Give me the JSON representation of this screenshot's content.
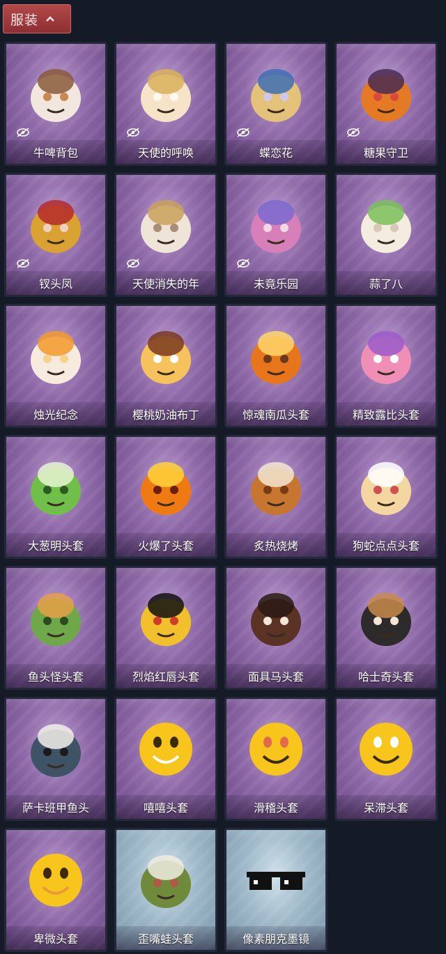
{
  "header": {
    "title": "服装",
    "icon": "chevron-up-icon"
  },
  "items": [
    {
      "name": "牛啤背包",
      "hidden": true,
      "theme": "purple",
      "art": "cow-backpack-icon",
      "colors": [
        "#f2e7df",
        "#8a5a3a",
        "#c9894e"
      ]
    },
    {
      "name": "天使的呼唤",
      "hidden": true,
      "theme": "purple",
      "art": "angel-charm-icon",
      "colors": [
        "#f6e3c8",
        "#d9b25a",
        "#fffaf0"
      ]
    },
    {
      "name": "蝶恋花",
      "hidden": true,
      "theme": "purple",
      "art": "butterfly-bell-icon",
      "colors": [
        "#e5c27a",
        "#3e6fb3",
        "#d0c8e8"
      ]
    },
    {
      "name": "糖果守卫",
      "hidden": true,
      "theme": "purple",
      "art": "pumpkin-guard-icon",
      "colors": [
        "#e57a24",
        "#4a2c53",
        "#d94a3a"
      ]
    },
    {
      "name": "钗头凤",
      "hidden": true,
      "theme": "purple",
      "art": "phoenix-crown-icon",
      "colors": [
        "#d9a233",
        "#b42a2a",
        "#f2d0c0"
      ]
    },
    {
      "name": "天使消失的年",
      "hidden": true,
      "theme": "purple",
      "art": "veiled-angel-icon",
      "colors": [
        "#efe4d8",
        "#c9a15a",
        "#a88e79"
      ]
    },
    {
      "name": "未竟乐园",
      "hidden": true,
      "theme": "purple",
      "art": "wonderland-doll-icon",
      "colors": [
        "#d77fb8",
        "#7b6acf",
        "#f2d8e4"
      ]
    },
    {
      "name": "蒜了八",
      "hidden": false,
      "theme": "purple",
      "art": "garlic-icon",
      "colors": [
        "#f3ecdf",
        "#7bbf5a",
        "#d6c9b8"
      ]
    },
    {
      "name": "烛光纪念",
      "hidden": false,
      "theme": "purple",
      "art": "candle-icon",
      "colors": [
        "#f7eadf",
        "#f39a2c",
        "#f6d28a"
      ]
    },
    {
      "name": "樱桃奶油布丁",
      "hidden": false,
      "theme": "purple",
      "art": "pudding-icon",
      "colors": [
        "#f6c25b",
        "#7a3b1e",
        "#ffffff"
      ]
    },
    {
      "name": "惊魂南瓜头套",
      "hidden": false,
      "theme": "purple",
      "art": "jack-o-lantern-icon",
      "colors": [
        "#e6751c",
        "#ffd76a",
        "#6b3a1a"
      ]
    },
    {
      "name": "精致露比头套",
      "hidden": false,
      "theme": "purple",
      "art": "pink-bear-icon",
      "colors": [
        "#f08fb5",
        "#9a5cc9",
        "#ffffff"
      ]
    },
    {
      "name": "大葱明头套",
      "hidden": false,
      "theme": "purple",
      "art": "green-onion-icon",
      "colors": [
        "#6fbf4a",
        "#e8f3d0",
        "#2c5a23"
      ]
    },
    {
      "name": "火爆了头套",
      "hidden": false,
      "theme": "purple",
      "art": "fire-face-icon",
      "colors": [
        "#f07a12",
        "#ffd23a",
        "#6a1f0f"
      ]
    },
    {
      "name": "炙热烧烤",
      "hidden": false,
      "theme": "purple",
      "art": "bbq-meat-icon",
      "colors": [
        "#c7762f",
        "#f3e6d2",
        "#7a3a18"
      ]
    },
    {
      "name": "狗蛇点点头套",
      "hidden": false,
      "theme": "purple",
      "art": "snake-dog-icon",
      "colors": [
        "#f3d6a0",
        "#ffffff",
        "#d05050"
      ]
    },
    {
      "name": "鱼头怪头套",
      "hidden": false,
      "theme": "purple",
      "art": "fish-mask-icon",
      "colors": [
        "#6fa84a",
        "#e6a046",
        "#2c4a1f"
      ]
    },
    {
      "name": "烈焰红唇头套",
      "hidden": false,
      "theme": "purple",
      "art": "yellow-mask-sunglasses-icon",
      "colors": [
        "#f2c02c",
        "#111111",
        "#d23a2a"
      ]
    },
    {
      "name": "面具马头套",
      "hidden": false,
      "theme": "purple",
      "art": "horse-mask-icon",
      "colors": [
        "#5a3324",
        "#2a1a14",
        "#f3e6d8"
      ]
    },
    {
      "name": "哈士奇头套",
      "hidden": false,
      "theme": "purple",
      "art": "husky-sunglasses-icon",
      "colors": [
        "#2c2a2a",
        "#c98a4a",
        "#f3e6d2"
      ]
    },
    {
      "name": "萨卡班甲鱼头",
      "hidden": false,
      "theme": "purple",
      "art": "sacabambaspis-icon",
      "colors": [
        "#3e5366",
        "#f2f0ea",
        "#1a1a1a"
      ]
    },
    {
      "name": "嘻嘻头套",
      "hidden": false,
      "theme": "purple",
      "art": "grin-emoji-icon",
      "colors": [
        "#f7c51c",
        "#3a2a10",
        "#ffffff"
      ]
    },
    {
      "name": "滑稽头套",
      "hidden": false,
      "theme": "purple",
      "art": "smirk-emoji-icon",
      "colors": [
        "#f7c51c",
        "#e06a4a",
        "#3a2a10"
      ]
    },
    {
      "name": "呆滞头套",
      "hidden": false,
      "theme": "purple",
      "art": "stunned-emoji-icon",
      "colors": [
        "#f7c51c",
        "#ffffff",
        "#3a2a10"
      ]
    },
    {
      "name": "卑微头套",
      "hidden": false,
      "theme": "purple",
      "art": "shy-emoji-icon",
      "colors": [
        "#f7c51c",
        "#3a2a10",
        "#e79a3a"
      ]
    },
    {
      "name": "歪嘴蛙头套",
      "hidden": false,
      "theme": "blue",
      "art": "frog-mask-icon",
      "colors": [
        "#6f8a3a",
        "#f0ece0",
        "#b25a4a"
      ]
    },
    {
      "name": "像素朋克墨镜",
      "hidden": false,
      "theme": "blue",
      "art": "pixel-sunglasses-icon",
      "colors": [
        "#111111",
        "#ffffff",
        "#333333"
      ]
    }
  ]
}
